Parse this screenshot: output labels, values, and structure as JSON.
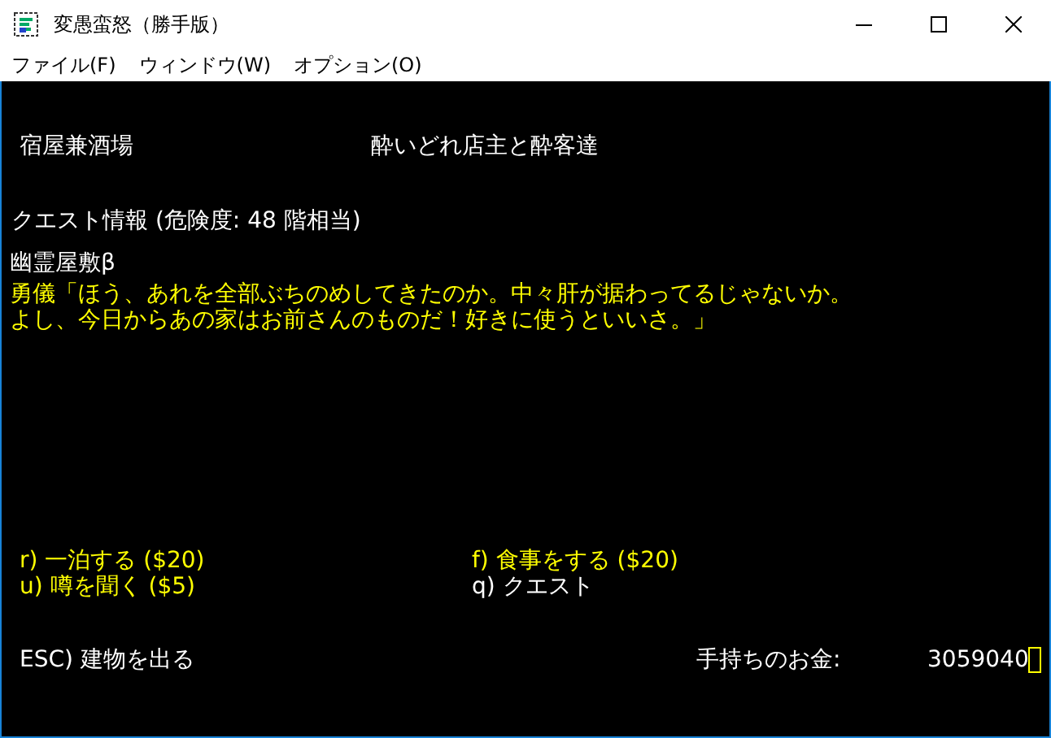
{
  "window": {
    "title": "変愚蛮怒（勝手版）"
  },
  "menu": [
    "ファイル(F)",
    "ウィンドウ(W)",
    "オプション(O)"
  ],
  "header": {
    "building": "宿屋兼酒場",
    "owner": "酔いどれ店主と酔客達"
  },
  "quest_info": "クエスト情報 (危険度: 48 階相当)",
  "quest_name": "幽霊屋敷β",
  "dialogue": [
    "勇儀「ほう、あれを全部ぶちのめしてきたのか。中々肝が据わってるじゃないか。",
    "よし、今日からあの家はお前さんのものだ！好きに使うといいさ。」"
  ],
  "options": [
    {
      "key": "r)",
      "label": "一泊する ($20)",
      "color": "#ffff00"
    },
    {
      "key": "f)",
      "label": "食事をする ($20)",
      "color": "#ffff00"
    },
    {
      "key": "u)",
      "label": "噂を聞く ($5)",
      "color": "#ffff00"
    },
    {
      "key": "q)",
      "label": "クエスト",
      "color": "#ffffff"
    }
  ],
  "exit": {
    "key": "ESC)",
    "label": "建物を出る"
  },
  "gold": {
    "label": "手持ちのお金:",
    "value": "3059040"
  }
}
